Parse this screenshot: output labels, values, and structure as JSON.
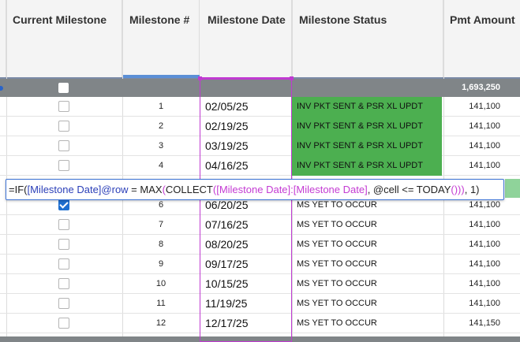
{
  "columns": {
    "current_milestone": "Current Milestone",
    "milestone_num": "Milestone #",
    "milestone_date": "Milestone Date",
    "milestone_status": "Milestone Status",
    "pmt_amount": "Pmt Amount"
  },
  "parent_row": {
    "pmt_total": "1,693,250"
  },
  "rows": [
    {
      "num": "1",
      "date": "02/05/25",
      "status": "INV PKT SENT & PSR XL UPDT",
      "amount": "141,100",
      "checked": false,
      "status_color": "#4caf50"
    },
    {
      "num": "2",
      "date": "02/19/25",
      "status": "INV PKT SENT & PSR XL UPDT",
      "amount": "141,100",
      "checked": false,
      "status_color": "#4caf50"
    },
    {
      "num": "3",
      "date": "03/19/25",
      "status": "INV PKT SENT & PSR XL UPDT",
      "amount": "141,100",
      "checked": false,
      "status_color": "#4caf50"
    },
    {
      "num": "4",
      "date": "04/16/25",
      "status": "INV PKT SENT & PSR XL UPDT",
      "amount": "141,100",
      "checked": false,
      "status_color": "#4caf50"
    },
    {
      "num": "6",
      "date": "06/20/25",
      "status": "MS YET TO OCCUR",
      "amount": "141,100",
      "checked": true,
      "status_color": ""
    },
    {
      "num": "7",
      "date": "07/16/25",
      "status": "MS YET TO OCCUR",
      "amount": "141,100",
      "checked": false,
      "status_color": ""
    },
    {
      "num": "8",
      "date": "08/20/25",
      "status": "MS YET TO OCCUR",
      "amount": "141,100",
      "checked": false,
      "status_color": ""
    },
    {
      "num": "9",
      "date": "09/17/25",
      "status": "MS YET TO OCCUR",
      "amount": "141,100",
      "checked": false,
      "status_color": ""
    },
    {
      "num": "10",
      "date": "10/15/25",
      "status": "MS YET TO OCCUR",
      "amount": "141,100",
      "checked": false,
      "status_color": ""
    },
    {
      "num": "11",
      "date": "11/19/25",
      "status": "MS YET TO OCCUR",
      "amount": "141,100",
      "checked": false,
      "status_color": ""
    },
    {
      "num": "12",
      "date": "12/17/25",
      "status": "MS YET TO OCCUR",
      "amount": "141,150",
      "checked": false,
      "status_color": ""
    }
  ],
  "formula": {
    "p1": "=IF(",
    "ref1": "[Milestone Date]@row",
    "p2": " = MAX",
    "paren_open": "(",
    "p3": "COLLECT",
    "paren_open2": "(",
    "ref2": "[Milestone Date]:[Milestone Date]",
    "p4": ", @cell <= TODAY",
    "paren_close": "()))",
    "p5": ", 1)"
  },
  "colors": {
    "status_green": "#4caf50",
    "selection": "#c03ad1",
    "checkbox_checked": "#1f6fd0",
    "parent_row": "#808588"
  }
}
